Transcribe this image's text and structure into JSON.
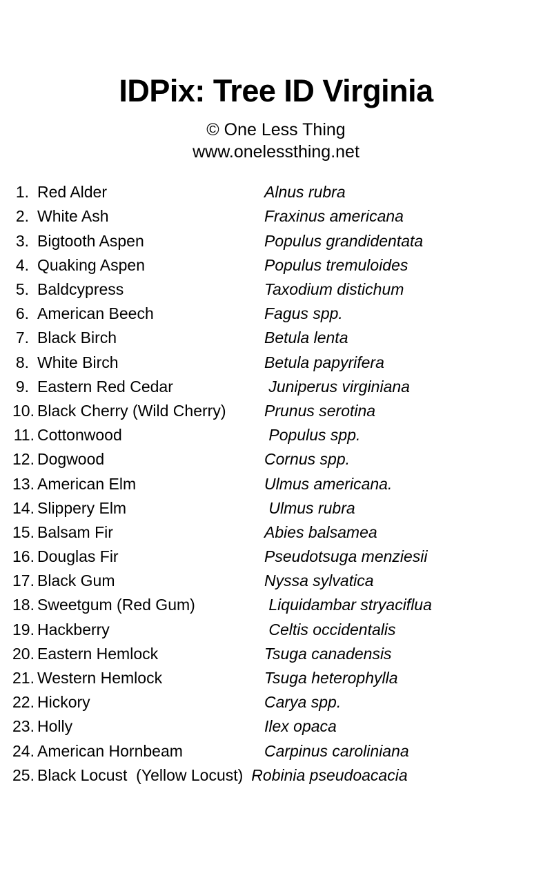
{
  "header": {
    "title": "IDPix: Tree ID Virginia",
    "copyright": "© One Less Thing",
    "website": "www.onelessthing.net"
  },
  "list": {
    "items": [
      {
        "number": "1.",
        "common": "Red Alder",
        "scientific": "Alnus rubra"
      },
      {
        "number": "2.",
        "common": "White Ash",
        "scientific": "Fraxinus americana"
      },
      {
        "number": "3.",
        "common": "Bigtooth Aspen",
        "scientific": "Populus grandidentata"
      },
      {
        "number": "4.",
        "common": "Quaking Aspen",
        "scientific": "Populus tremuloides"
      },
      {
        "number": "5.",
        "common": "Baldcypress",
        "scientific": "Taxodium distichum"
      },
      {
        "number": "6.",
        "common": "American Beech",
        "scientific": "Fagus spp."
      },
      {
        "number": "7.",
        "common": "Black Birch",
        "scientific": "Betula lenta"
      },
      {
        "number": "8.",
        "common": "White Birch",
        "scientific": "Betula papyrifera"
      },
      {
        "number": "9.",
        "common": "Eastern Red Cedar",
        "scientific": " Juniperus virginiana"
      },
      {
        "number": "10.",
        "common": "Black Cherry (Wild Cherry)",
        "scientific": "Prunus serotina"
      },
      {
        "number": "11.",
        "common": "Cottonwood",
        "scientific": " Populus spp."
      },
      {
        "number": "12.",
        "common": "Dogwood",
        "scientific": "Cornus spp."
      },
      {
        "number": "13.",
        "common": "American Elm",
        "scientific": "Ulmus americana."
      },
      {
        "number": "14.",
        "common": "Slippery Elm",
        "scientific": " Ulmus rubra"
      },
      {
        "number": "15.",
        "common": "Balsam Fir",
        "scientific": "Abies balsamea"
      },
      {
        "number": "16.",
        "common": "Douglas Fir",
        "scientific": "Pseudotsuga menziesii"
      },
      {
        "number": "17.",
        "common": "Black Gum",
        "scientific": "Nyssa sylvatica"
      },
      {
        "number": "18.",
        "common": "Sweetgum (Red Gum)",
        "scientific": " Liquidambar stryaciflua"
      },
      {
        "number": "19.",
        "common": "Hackberry",
        "scientific": " Celtis occidentalis"
      },
      {
        "number": "20.",
        "common": "Eastern Hemlock",
        "scientific": "Tsuga canadensis"
      },
      {
        "number": "21.",
        "common": "Western Hemlock",
        "scientific": "Tsuga heterophylla"
      },
      {
        "number": "22.",
        "common": "Hickory",
        "scientific": "Carya spp."
      },
      {
        "number": "23.",
        "common": "Holly",
        "scientific": "Ilex opaca"
      },
      {
        "number": "24.",
        "common": "American Hornbeam",
        "scientific": "Carpinus caroliniana"
      },
      {
        "number": "25.",
        "common": "Black Locust  (Yellow Locust)",
        "scientific": "Robinia pseudoacacia"
      }
    ]
  },
  "colors": {
    "background": "#ffffff",
    "text": "#000000"
  }
}
